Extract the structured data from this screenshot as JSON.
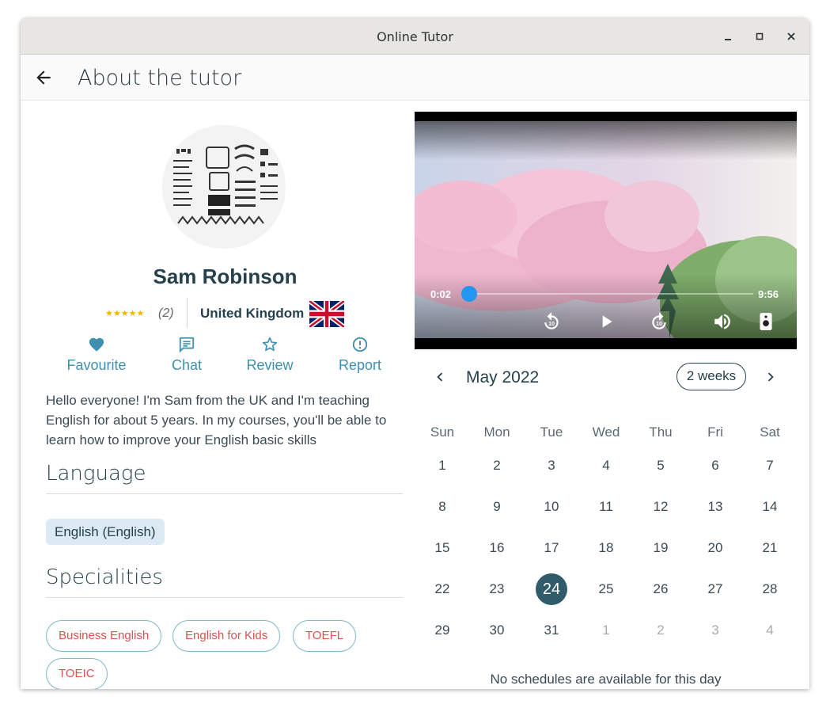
{
  "window": {
    "title": "Online Tutor"
  },
  "appbar": {
    "title": "About the tutor"
  },
  "tutor": {
    "name": "Sam Robinson",
    "stars": "★★★★★",
    "rating_count": "(2)",
    "country": "United Kingdom",
    "bio": "Hello everyone! I'm Sam from the UK and I'm teaching English for about 5 years. In my courses, you'll be able to learn how to improve your English basic skills"
  },
  "actions": {
    "favourite": "Favourite",
    "chat": "Chat",
    "review": "Review",
    "report": "Report"
  },
  "sections": {
    "language": "Language",
    "specialities": "Specialities"
  },
  "languages": [
    "English (English)"
  ],
  "specialities": [
    "Business English",
    "English for Kids",
    "TOEFL",
    "TOEIC"
  ],
  "video": {
    "current_time": "0:02",
    "duration": "9:56",
    "progress": 0.003
  },
  "calendar": {
    "month": "May 2022",
    "range_button": "2 weeks",
    "weekdays": [
      "Sun",
      "Mon",
      "Tue",
      "Wed",
      "Thu",
      "Fri",
      "Sat"
    ],
    "weeks": [
      [
        "1",
        "2",
        "3",
        "4",
        "5",
        "6",
        "7"
      ],
      [
        "8",
        "9",
        "10",
        "11",
        "12",
        "13",
        "14"
      ],
      [
        "15",
        "16",
        "17",
        "18",
        "19",
        "20",
        "21"
      ],
      [
        "22",
        "23",
        "24",
        "25",
        "26",
        "27",
        "28"
      ],
      [
        "29",
        "30",
        "31",
        "1",
        "2",
        "3",
        "4"
      ]
    ],
    "selected": "24",
    "empty_message": "No schedules are available for this day"
  },
  "colors": {
    "primary": "#25414e",
    "accent": "#3f90b0",
    "chip_text": "#d9534f",
    "selected_day": "#2f5b6b",
    "video_thumb": "#2196f3",
    "star": "#f5b400"
  }
}
